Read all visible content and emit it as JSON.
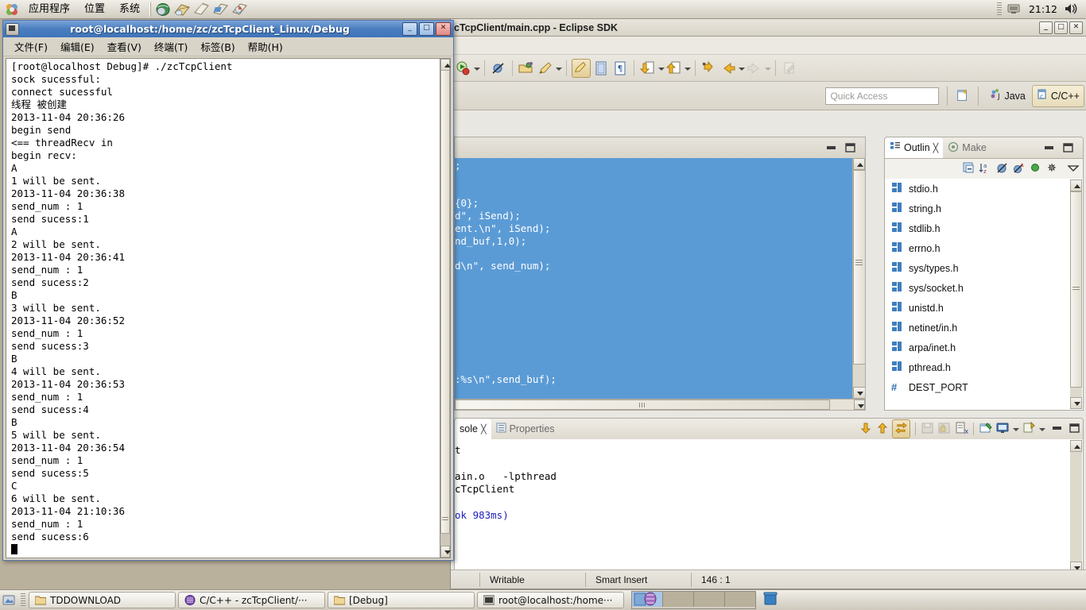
{
  "desktop": {
    "top_panel": {
      "menus": [
        "应用程序",
        "位置",
        "系统"
      ],
      "launchers": [
        "web-browser-icon",
        "email-icon",
        "writer-icon",
        "spreadsheet-icon",
        "presentation-icon"
      ],
      "tray": {
        "clock": "21:12",
        "icons": [
          "display-icon",
          "volume-icon"
        ]
      }
    },
    "taskbar": {
      "items": [
        {
          "label": "TDDOWNLOAD",
          "icon": "folder-icon"
        },
        {
          "label": "C/C++ - zcTcpClient/···",
          "icon": "eclipse-icon"
        },
        {
          "label": "[Debug]",
          "icon": "folder-icon"
        },
        {
          "label": "root@localhost:/home···",
          "icon": "terminal-icon"
        }
      ],
      "workspaces": 4,
      "active_workspace": 1,
      "trash_icon": "trash-icon"
    }
  },
  "terminal": {
    "title": "root@localhost:/home/zc/zcTcpClient_Linux/Debug",
    "window_buttons": [
      "_",
      "□",
      "✕"
    ],
    "menus": [
      "文件(F)",
      "编辑(E)",
      "查看(V)",
      "终端(T)",
      "标签(B)",
      "帮助(H)"
    ],
    "output": "[root@localhost Debug]# ./zcTcpClient\nsock sucessful:\nconnect sucessful\n线程 被创建\n2013-11-04 20:36:26\nbegin send\n<== threadRecv in\nbegin recv:\nA\n1 will be sent.\n2013-11-04 20:36:38\nsend_num : 1\nsend sucess:1\nA\n2 will be sent.\n2013-11-04 20:36:41\nsend_num : 1\nsend sucess:2\nB\n3 will be sent.\n2013-11-04 20:36:52\nsend_num : 1\nsend sucess:3\nB\n4 will be sent.\n2013-11-04 20:36:53\nsend_num : 1\nsend sucess:4\nB\n5 will be sent.\n2013-11-04 20:36:54\nsend_num : 1\nsend sucess:5\nC\n6 will be sent.\n2013-11-04 21:10:36\nsend_num : 1\nsend sucess:6"
  },
  "eclipse": {
    "title": "cTcpClient/main.cpp - Eclipse SDK",
    "window_buttons": [
      "_",
      "□",
      "✕"
    ],
    "toolbar": {
      "icons": [
        "run-debug-icon",
        "skip-breakpoints-icon",
        "open-type-icon",
        "build-icon",
        "toggle-mark-occurrences-icon",
        "show-whitespace-icon",
        "pilcrow-icon",
        "next-annotation-icon",
        "previous-annotation-icon",
        "last-edit-location-icon",
        "back-icon",
        "forward-icon",
        "new-editor-icon"
      ]
    },
    "quick_access": {
      "placeholder": "Quick Access"
    },
    "perspectives": [
      {
        "label": "Java",
        "icon": "java-perspective-icon",
        "active": false
      },
      {
        "label": "C/C++",
        "icon": "cpp-perspective-icon",
        "active": true
      }
    ],
    "open_perspective_icon": "open-perspective-icon",
    "editor": {
      "code_lines": [
        ";",
        "",
        "",
        "{0};",
        "d\", iSend);",
        "ent.\\n\", iSend);",
        "nd_buf,1,0);",
        "",
        "d\\n\", send_num);",
        "",
        "",
        "",
        "",
        "",
        "",
        "",
        "",
        ":%s\\n\",send_buf);"
      ],
      "selection_color": "#5b9bd5"
    },
    "outline": {
      "tabs": [
        {
          "label": "Outlin",
          "icon": "outline-icon",
          "active": true,
          "close_icon": "close-icon"
        },
        {
          "label": "Make",
          "icon": "make-target-icon",
          "active": false
        }
      ],
      "toolbar_icons": [
        "collapse-all-icon",
        "sort-icon",
        "hide-fields-icon",
        "hide-static-icon",
        "hide-nonpublic-icon",
        "hide-macros-icon",
        "view-menu-icon"
      ],
      "minimize_icon": "minimize-icon",
      "maximize_icon": "maximize-icon",
      "items": [
        {
          "label": "stdio.h",
          "icon": "include-icon"
        },
        {
          "label": "string.h",
          "icon": "include-icon"
        },
        {
          "label": "stdlib.h",
          "icon": "include-icon"
        },
        {
          "label": "errno.h",
          "icon": "include-icon"
        },
        {
          "label": "sys/types.h",
          "icon": "include-icon"
        },
        {
          "label": "sys/socket.h",
          "icon": "include-icon"
        },
        {
          "label": "unistd.h",
          "icon": "include-icon"
        },
        {
          "label": "netinet/in.h",
          "icon": "include-icon"
        },
        {
          "label": "arpa/inet.h",
          "icon": "include-icon"
        },
        {
          "label": "pthread.h",
          "icon": "include-icon"
        },
        {
          "label": "DEST_PORT",
          "icon": "macro-icon"
        }
      ]
    },
    "console": {
      "tabs": [
        {
          "label": "sole",
          "icon": "console-icon",
          "active": true,
          "close_icon": "close-icon"
        },
        {
          "label": "Properties",
          "icon": "properties-icon",
          "active": false
        }
      ],
      "toolbar_icons": [
        "scroll-down-icon",
        "scroll-up-icon",
        "scroll-lock-icon",
        "save-console-icon",
        "lock-console-icon",
        "clear-console-icon",
        "open-console-icon",
        "display-console-icon",
        "new-console-icon",
        "minimize-icon",
        "maximize-icon"
      ],
      "lines": [
        {
          "text": "t",
          "color": "#000000"
        },
        {
          "text": "",
          "color": "#000000"
        },
        {
          "text": "ain.o   -lpthread",
          "color": "#000000"
        },
        {
          "text": "cTcpClient",
          "color": "#000000"
        },
        {
          "text": "",
          "color": "#000000"
        },
        {
          "text": "ok 983ms)",
          "color": "#2020c0"
        }
      ]
    },
    "status_bar": {
      "writable": "Writable",
      "insert_mode": "Smart Insert",
      "position": "146 : 1"
    }
  }
}
